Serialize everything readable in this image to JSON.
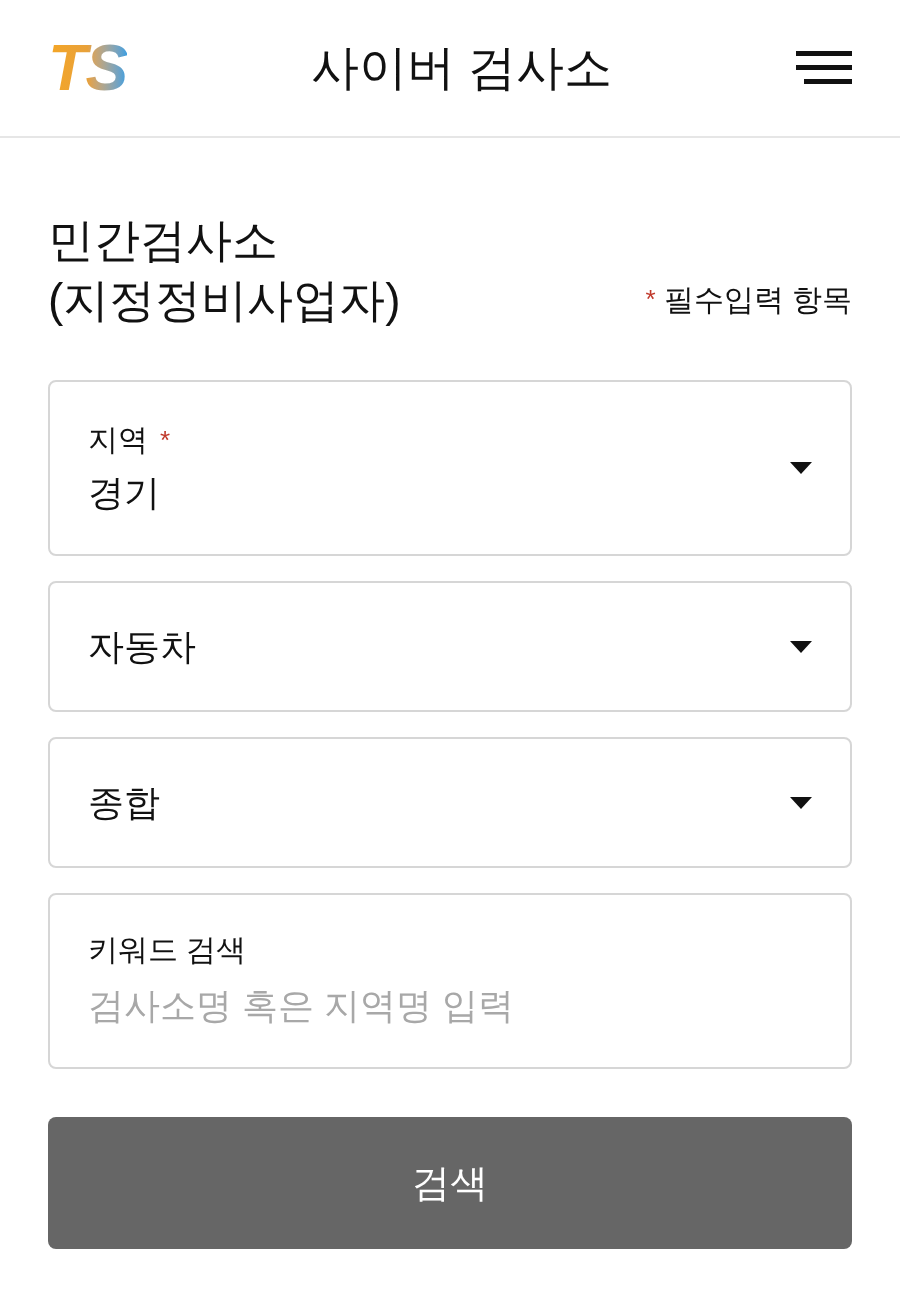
{
  "header": {
    "logo": "TS",
    "title": "사이버 검사소"
  },
  "section": {
    "title_lines": [
      "민간검사소",
      "(지정정비사업자)"
    ],
    "required_mark": "*",
    "required_note": "필수입력 항목"
  },
  "fields": [
    {
      "kind": "select",
      "label": "지역",
      "required": true,
      "value": "경기"
    },
    {
      "kind": "select",
      "value": "자동차"
    },
    {
      "kind": "select",
      "value": "종합"
    },
    {
      "kind": "input",
      "label": "키워드 검색",
      "placeholder": "검사소명 혹은 지역명 입력"
    }
  ],
  "search_button": "검색"
}
